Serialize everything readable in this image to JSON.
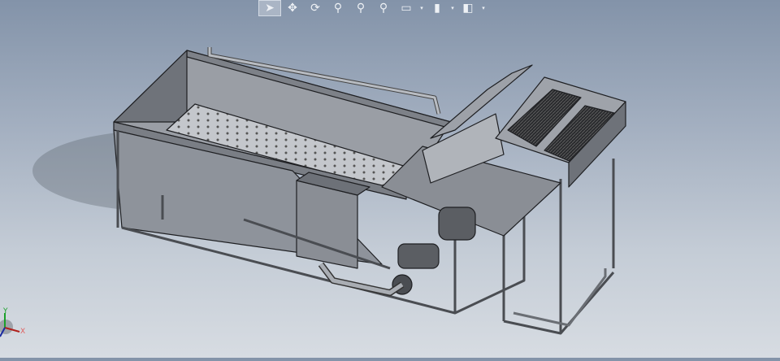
{
  "toolbar": {
    "items": [
      {
        "icon": "select-arrow-icon",
        "glyph": "➤"
      },
      {
        "icon": "pan-icon",
        "glyph": "✥"
      },
      {
        "icon": "rotate-icon",
        "glyph": "⟳"
      },
      {
        "icon": "zoom-to-fit-icon",
        "glyph": "⚲"
      },
      {
        "icon": "zoom-to-area-icon",
        "glyph": "⚲"
      },
      {
        "icon": "zoom-in-out-icon",
        "glyph": "⚲"
      },
      {
        "icon": "display-style-icon",
        "glyph": "▭"
      },
      {
        "icon": "hide-show-icon",
        "glyph": "▮"
      },
      {
        "icon": "view-orientation-icon",
        "glyph": "◧"
      }
    ],
    "dropdown_glyph": "▾"
  },
  "triad": {
    "x_label": "X",
    "y_label": "Y"
  },
  "colors": {
    "model_fill": "#8e939b",
    "model_dark": "#5d6168",
    "model_light": "#b9bdc3",
    "edge": "#1e1f22"
  }
}
